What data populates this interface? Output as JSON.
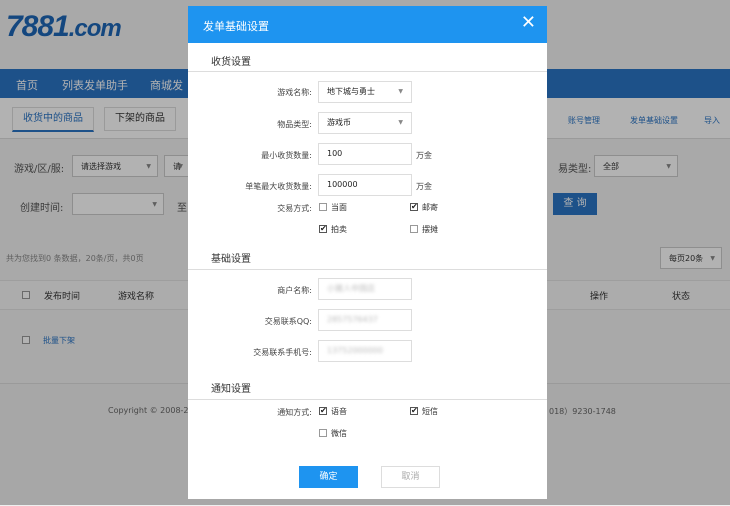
{
  "background": {
    "logo_main": "7881",
    "logo_suffix": ".com",
    "nav": [
      "首页",
      "列表发单助手",
      "商城发"
    ],
    "tabs": [
      "收货中的商品",
      "下架的商品"
    ],
    "right_links": [
      "账号管理",
      "发单基础设置",
      "导入"
    ],
    "filter": {
      "game_label": "游戏/区/服:",
      "game_select": "请选择游戏",
      "game_select2": "请",
      "type_label": "易类型:",
      "type_select": "全部",
      "time_label": "创建时间:",
      "time_to": "至",
      "query_button": "查 询"
    },
    "summary": "共为您找到0 条数据，20条/页，共0页",
    "per_page": "每页20条",
    "table_headers": [
      "发布时间",
      "游戏名称",
      "操作",
      "状态"
    ],
    "batch_action": "批量下架",
    "footer_left": "Copyright © 2008-2",
    "footer_right": "018）9230-1748"
  },
  "modal": {
    "title": "发单基础设置",
    "close": "✕",
    "section_receive": "收货设置",
    "game_name_label": "游戏名称:",
    "game_name_value": "地下城与勇士",
    "item_type_label": "物品类型:",
    "item_type_value": "游戏币",
    "min_qty_label": "最小收货数量:",
    "min_qty_value": "100",
    "min_qty_unit": "万金",
    "max_qty_label": "单笔最大收货数量:",
    "max_qty_value": "100000",
    "max_qty_unit": "万金",
    "trade_method_label": "交易方式:",
    "trade_methods": [
      {
        "label": "当面",
        "checked": false
      },
      {
        "label": "邮寄",
        "checked": true
      },
      {
        "label": "拍卖",
        "checked": true
      },
      {
        "label": "摆摊",
        "checked": false
      }
    ],
    "section_basic": "基础设置",
    "merchant_label": "商户名称:",
    "merchant_value": "小猪人中国店",
    "qq_label": "交易联系QQ:",
    "qq_value": "2857576437",
    "phone_label": "交易联系手机号:",
    "phone_value": "13752000000",
    "section_notify": "通知设置",
    "notify_label": "通知方式:",
    "notify_methods": [
      {
        "label": "语音",
        "checked": true
      },
      {
        "label": "短信",
        "checked": true
      },
      {
        "label": "微信",
        "checked": false
      }
    ],
    "ok_button": "确定",
    "cancel_button": "取消"
  }
}
